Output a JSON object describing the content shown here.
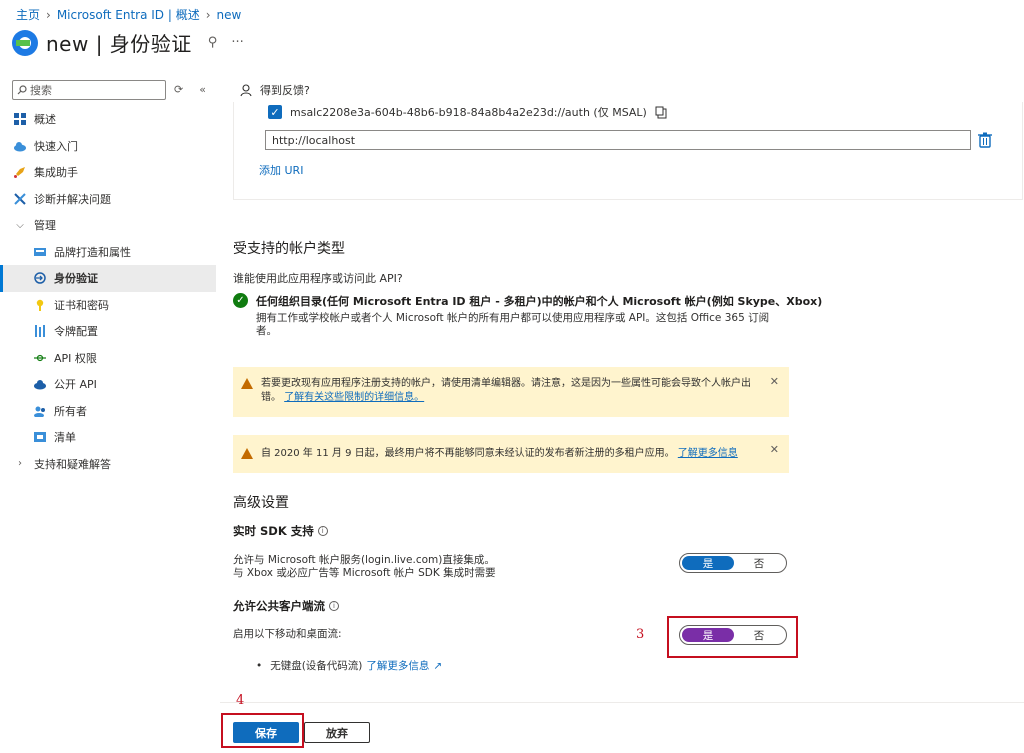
{
  "breadcrumb": [
    "主页",
    "Microsoft Entra ID | 概述",
    "new"
  ],
  "title": "new | 身份验证",
  "sidebar": {
    "search_placeholder": "搜索",
    "items": [
      {
        "label": "概述",
        "icon": "overview-grid-icon"
      },
      {
        "label": "快速入门",
        "icon": "quickstart-cloud-icon"
      },
      {
        "label": "集成助手",
        "icon": "rocket-icon"
      },
      {
        "label": "诊断并解决问题",
        "icon": "wrench-icon"
      },
      {
        "label": "管理",
        "icon": "chevron-down-icon"
      },
      {
        "label": "品牌打造和属性",
        "icon": "branding-icon"
      },
      {
        "label": "身份验证",
        "icon": "authentication-icon"
      },
      {
        "label": "证书和密码",
        "icon": "key-icon"
      },
      {
        "label": "令牌配置",
        "icon": "token-icon"
      },
      {
        "label": "API 权限",
        "icon": "api-permissions-icon"
      },
      {
        "label": "公开 API",
        "icon": "cloud-api-icon"
      },
      {
        "label": "所有者",
        "icon": "owners-icon"
      },
      {
        "label": "清单",
        "icon": "manifest-icon"
      },
      {
        "label": "支持和疑难解答",
        "icon": "chevron-right-icon"
      }
    ]
  },
  "feedback": "得到反馈?",
  "redirect": {
    "msal_uri": "msalc2208e3a-604b-48b6-b918-84a8b4a2e23d://auth (仅 MSAL)",
    "uri_value": "http://localhost",
    "add_uri": "添加 URI"
  },
  "account_types": {
    "heading": "受支持的帐户类型",
    "question": "谁能使用此应用程序或访问此 API?",
    "option_title": "任何组织目录(任何 Microsoft Entra ID 租户 - 多租户)中的帐户和个人 Microsoft 帐户(例如 Skype、Xbox)",
    "option_desc": "拥有工作或学校帐户或者个人 Microsoft 帐户的所有用户都可以使用应用程序或 API。这包括 Office 365 订阅者。"
  },
  "warnings": [
    {
      "text": "若要更改现有应用程序注册支持的帐户，请使用清单编辑器。请注意，这是因为一些属性可能会导致个人帐户出错。",
      "link": "了解有关这些限制的详细信息。"
    },
    {
      "text": "自 2020 年 11 月 9 日起，最终用户将不再能够同意未经认证的发布者新注册的多租户应用。",
      "link": "了解更多信息"
    }
  ],
  "advanced": {
    "heading": "高级设置",
    "sdk": {
      "title": "实时 SDK 支持",
      "desc1": "允许与 Microsoft 帐户服务(login.live.com)直接集成。",
      "desc2": "与 Xbox 或必应广告等 Microsoft 帐户 SDK 集成时需要",
      "on": "是",
      "off": "否",
      "on_color": "#0f6cbd"
    },
    "public": {
      "title": "允许公共客户端流",
      "desc": "启用以下移动和桌面流:",
      "on": "是",
      "off": "否",
      "on_color": "#7a2ea7",
      "bullet": "无键盘(设备代码流)",
      "bullet_link": "了解更多信息"
    }
  },
  "annotations": {
    "step3": "3",
    "step4": "4"
  },
  "footer": {
    "save": "保存",
    "discard": "放弃"
  }
}
